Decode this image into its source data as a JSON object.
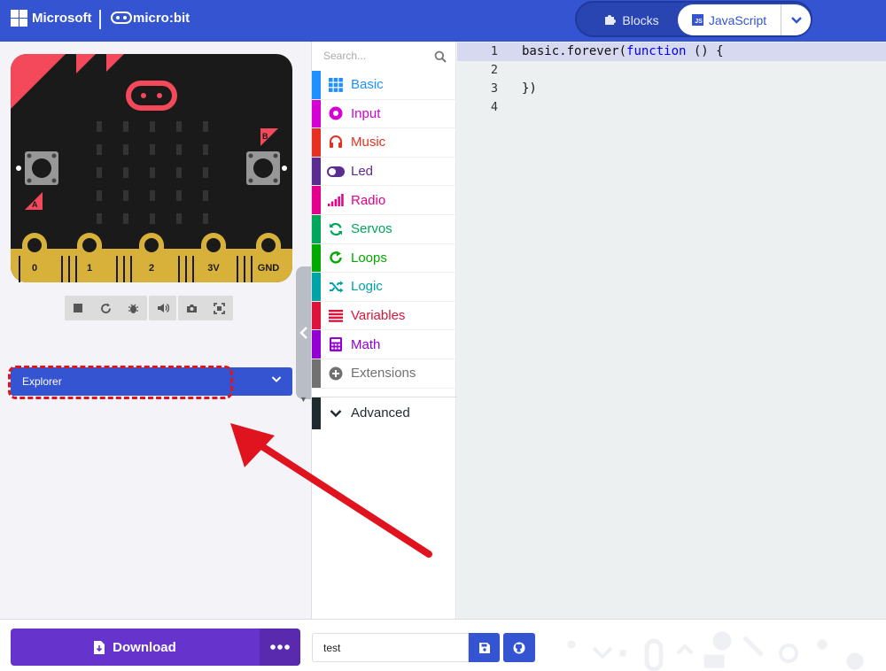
{
  "header": {
    "brand": "Microsoft",
    "product": "micro:bit",
    "modes": {
      "blocks": "Blocks",
      "javascript": "JavaScript",
      "js_badge": "JS"
    },
    "accent": "#3454d1"
  },
  "simulator": {
    "pins": [
      "0",
      "1",
      "2",
      "3V",
      "GND"
    ],
    "button_a": "A",
    "button_b": "B",
    "tools": [
      "stop-icon",
      "restart-icon",
      "debug-icon",
      "mute-icon",
      "screenshot-icon",
      "fullscreen-icon"
    ],
    "explorer_label": "Explorer"
  },
  "toolbox": {
    "search_placeholder": "Search...",
    "categories": [
      {
        "label": "Basic",
        "color": "#1e90ff",
        "icon": "grid-icon"
      },
      {
        "label": "Input",
        "color": "#d400d4",
        "icon": "circle-dot-icon"
      },
      {
        "label": "Music",
        "color": "#e63022",
        "icon": "headphones-icon"
      },
      {
        "label": "Led",
        "color": "#5c2d91",
        "icon": "toggle-icon"
      },
      {
        "label": "Radio",
        "color": "#e3008c",
        "icon": "signal-bars-icon"
      },
      {
        "label": "Servos",
        "color": "#00a65c",
        "icon": "refresh-icon"
      },
      {
        "label": "Loops",
        "color": "#00aa00",
        "icon": "loop-icon"
      },
      {
        "label": "Logic",
        "color": "#00a4a6",
        "icon": "shuffle-icon"
      },
      {
        "label": "Variables",
        "color": "#dc143c",
        "icon": "list-icon"
      },
      {
        "label": "Math",
        "color": "#9400d3",
        "icon": "calculator-icon"
      },
      {
        "label": "Extensions",
        "color": "#717171",
        "icon": "plus-circle-icon"
      }
    ],
    "advanced": {
      "label": "Advanced",
      "color": "#1e2a2d"
    }
  },
  "editor": {
    "line_numbers": [
      "1",
      "2",
      "3",
      "4"
    ],
    "line1_prefix": "basic.forever(",
    "line1_keyword": "function",
    "line1_suffix": " () {",
    "line3": "})"
  },
  "footer": {
    "download_label": "Download",
    "more_label": "•••",
    "project_name": "test"
  }
}
